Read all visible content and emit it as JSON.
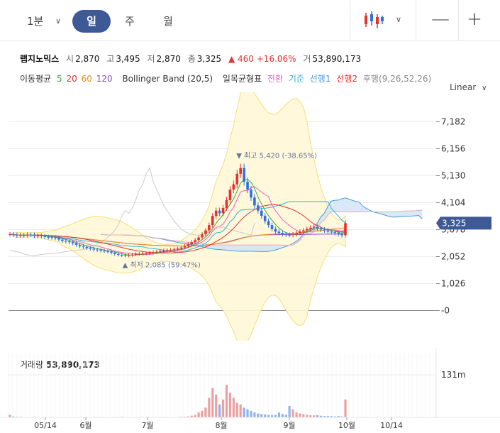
{
  "toolbar": {
    "tf_1min": "1분",
    "tf_day": "일",
    "tf_week": "주",
    "tf_month": "월",
    "zoom_out": "—",
    "zoom_in": "+"
  },
  "stock": {
    "name": "랩지노믹스",
    "open_label": "시",
    "open": "2,870",
    "high_label": "고",
    "high": "3,495",
    "low_label": "저",
    "low": "2,870",
    "close_label": "종",
    "close": "3,325",
    "change": "▲ 460",
    "change_pct": "+16.06%",
    "vol_label": "거",
    "volume": "53,890,173"
  },
  "indicators": {
    "ma_label": "이동평균",
    "ma5": "5",
    "ma20": "20",
    "ma60": "60",
    "ma120": "120",
    "bb": "Bollinger Band (20,5)",
    "ichimoku": "일목균형표",
    "conv": "전환",
    "base": "기준",
    "lead1": "선행1",
    "lead2": "선행2",
    "lag": "후행(9,26,52,26)"
  },
  "scale_label": "Linear",
  "colors": {
    "up": "#e5322f",
    "down": "#2f6fe5",
    "ma5": "#39a845",
    "ma20": "#e5322f",
    "ma60": "#f0891b",
    "ma120": "#8d4bd8",
    "conv": "#ee5fc2",
    "base": "#2bb5d8",
    "lead1": "#4a9bd8",
    "lead2": "#e5322f",
    "lag": "#999999",
    "price_badge": "#3d5a96"
  },
  "chart_data": {
    "type": "line",
    "title": "",
    "y_ticks": [
      "7,182",
      "6,156",
      "5,130",
      "4,104",
      "3,078",
      "2,052",
      "1,026",
      "-0"
    ],
    "y_tick_values": [
      7182,
      6156,
      5130,
      4104,
      3078,
      2052,
      1026,
      0
    ],
    "ylim": [
      -1200,
      8300
    ],
    "x_ticks": [
      "05/14",
      "6월",
      "7월",
      "8월",
      "9월",
      "10월",
      "10/14"
    ],
    "current_price": "3,325",
    "current_price_value": 3325,
    "high_annotation": "▼ 최고 5,420 (-38.65%)",
    "high_value": 5420,
    "low_annotation": "▲ 최저 2,085 (59.47%)",
    "low_value": 2085,
    "volume_title": "거래량",
    "volume_value": "53,890,173",
    "volume_tick": "131m",
    "volume_max": 131,
    "close": [
      2900,
      2880,
      2850,
      2870,
      2860,
      2890,
      2880,
      2840,
      2850,
      2830,
      2800,
      2790,
      2780,
      2760,
      2700,
      2650,
      2630,
      2600,
      2560,
      2500,
      2450,
      2420,
      2380,
      2350,
      2320,
      2300,
      2280,
      2260,
      2240,
      2200,
      2150,
      2120,
      2100,
      2085,
      2110,
      2130,
      2150,
      2160,
      2170,
      2180,
      2200,
      2220,
      2240,
      2260,
      2280,
      2300,
      2310,
      2330,
      2360,
      2400,
      2450,
      2520,
      2600,
      2680,
      2780,
      2900,
      3050,
      3250,
      3600,
      3800,
      3700,
      3900,
      4200,
      4600,
      4800,
      5200,
      5420,
      4900,
      4600,
      4300,
      4000,
      3800,
      3600,
      3400,
      3250,
      3100,
      3000,
      2950,
      2900,
      2880,
      2870,
      2900,
      2950,
      3000,
      3050,
      3100,
      3150,
      3180,
      3120,
      3080,
      3050,
      3000,
      2980,
      2950,
      2900,
      2865,
      3325
    ],
    "volume": [
      8,
      3,
      2,
      2,
      1,
      1,
      1,
      2,
      1,
      1,
      1,
      1,
      1,
      1,
      1,
      1,
      1,
      1,
      1,
      1,
      1,
      1,
      1,
      1,
      1,
      1,
      1,
      1,
      1,
      1,
      1,
      1,
      2,
      1,
      1,
      1,
      1,
      1,
      1,
      1,
      1,
      1,
      1,
      1,
      1,
      1,
      1,
      1,
      1,
      2,
      2,
      3,
      5,
      8,
      15,
      20,
      30,
      60,
      90,
      70,
      40,
      55,
      100,
      75,
      60,
      45,
      40,
      30,
      25,
      20,
      15,
      12,
      10,
      9,
      8,
      7,
      8,
      15,
      10,
      8,
      35,
      25,
      15,
      12,
      10,
      8,
      7,
      6,
      7,
      5,
      4,
      4,
      4,
      3,
      4,
      3,
      55
    ]
  }
}
